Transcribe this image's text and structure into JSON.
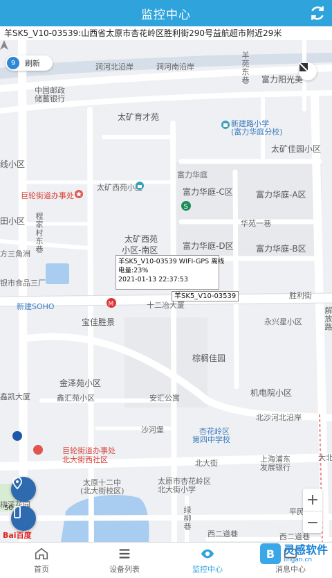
{
  "header": {
    "title": "监控中心"
  },
  "address": {
    "text": "羊SK5_V10-03539:山西省太原市杏花岭区胜利街290号益航超市附近29米"
  },
  "map": {
    "refresh": {
      "count": "9",
      "label": "刷新"
    },
    "labels": [
      "涧河北沿岸",
      "涧河南沿岸",
      "羊苑东巷",
      "富力阳光美",
      "中国邮政",
      "储蓄银行",
      "太矿育才苑",
      "新建路小学",
      "(富力华庭分校)",
      "太矿佳园小区",
      "线小区",
      "富力华庭",
      "巨轮街道办事处",
      "太矿西苑小区",
      "富力华庭-C区",
      "富力华庭-A区",
      "田小区",
      "程家村东巷",
      "华苑一巷",
      "太矿西苑",
      "小区-南区",
      "富力华庭-D区",
      "富力华庭-B区",
      "方三角洲",
      "银市食品三厂",
      "胜利街",
      "新建SOHO",
      "十二冶大厦",
      "宝佳胜景",
      "永兴星小区",
      "解放路",
      "棕榈佳园",
      "金泽苑小区",
      "鑫凯大厦",
      "鑫汇苑小区",
      "安汇公寓",
      "机电院小区",
      "北沙河北沿岸",
      "沙河堡",
      "杏花岭区",
      "第四中学校",
      "巨轮街道办事处",
      "北大街西社区",
      "北大街",
      "上海浦东",
      "发展银行",
      "大北",
      "太原十二中",
      "(北大街校区)",
      "太原市杏花岭区",
      "北大街小学",
      "柳溪花园",
      "绿柳巷",
      "西二道巷",
      "西二道巷",
      "平民小区"
    ],
    "info": {
      "line1": "羊SK5_V10-03539 WIFI-GPS 离线",
      "line2": "电量:23%",
      "line3": "2021-01-13 22:37:53"
    },
    "plate": "羊SK5_V10-03539",
    "scale": "50",
    "logo": "Bai百度"
  },
  "tabs": [
    {
      "label": "首页"
    },
    {
      "label": "设备列表"
    },
    {
      "label": "监控中心"
    },
    {
      "label": "消息中心"
    }
  ],
  "watermark": {
    "name": "灵感软件",
    "url": "lingan.cn"
  }
}
